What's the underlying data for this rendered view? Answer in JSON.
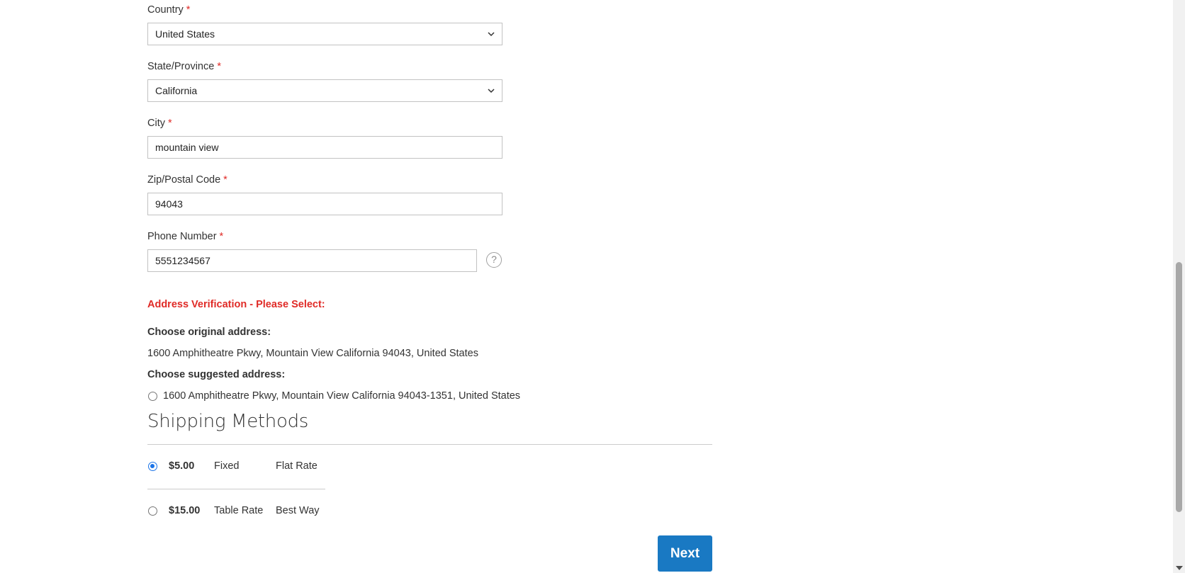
{
  "form": {
    "country": {
      "label": "Country",
      "required": "*",
      "value": "United States"
    },
    "state": {
      "label": "State/Province",
      "required": "*",
      "value": "California"
    },
    "city": {
      "label": "City",
      "required": "*",
      "value": "mountain view"
    },
    "zip": {
      "label": "Zip/Postal Code",
      "required": "*",
      "value": "94043"
    },
    "phone": {
      "label": "Phone Number",
      "required": "*",
      "value": "5551234567",
      "help_icon": "?"
    }
  },
  "address_verification": {
    "title": "Address Verification - Please Select:",
    "original_label": "Choose original address:",
    "original_address": "1600 Amphitheatre Pkwy, Mountain View California 94043, United States",
    "suggested_label": "Choose suggested address:",
    "suggested_address": "1600 Amphitheatre Pkwy, Mountain View California 94043-1351, United States",
    "suggested_selected": false
  },
  "shipping": {
    "title": "Shipping Methods",
    "methods": [
      {
        "price": "$5.00",
        "method": "Fixed",
        "carrier": "Flat Rate",
        "selected": true
      },
      {
        "price": "$15.00",
        "method": "Table Rate",
        "carrier": "Best Way",
        "selected": false
      }
    ]
  },
  "actions": {
    "next_label": "Next"
  },
  "colors": {
    "accent": "#1979c3",
    "error": "#e02b27",
    "radio_checked": "#1a73e8"
  }
}
